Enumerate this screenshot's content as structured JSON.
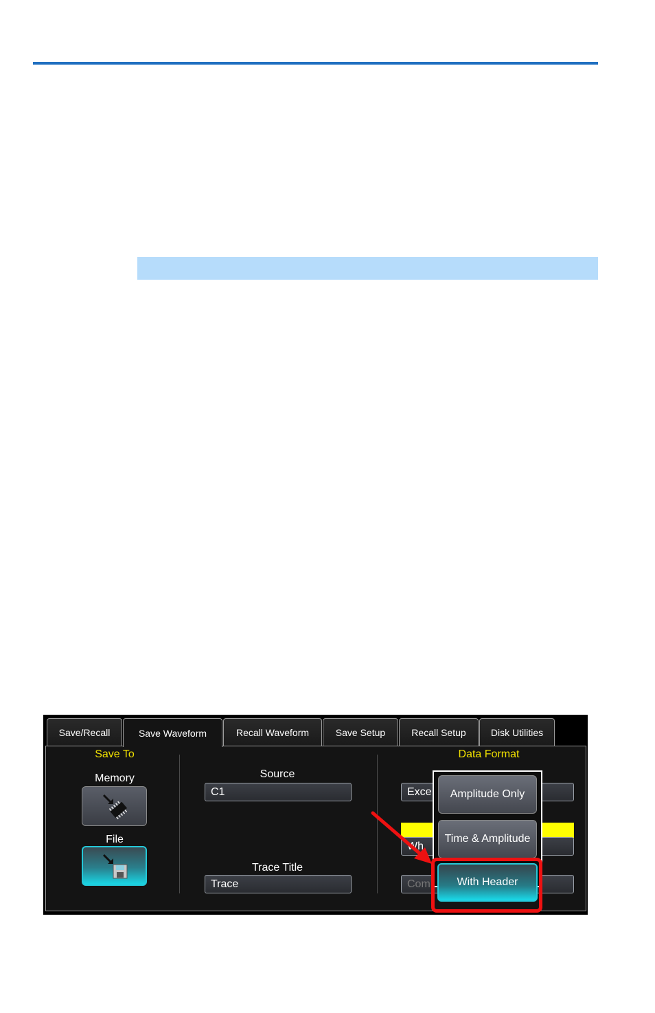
{
  "tabs": [
    "Save/Recall",
    "Save Waveform",
    "Recall Waveform",
    "Save Setup",
    "Recall Setup",
    "Disk Utilities"
  ],
  "save_to": {
    "heading": "Save To",
    "memory_label": "Memory",
    "file_label": "File",
    "memory_icon": "memory-chip-icon",
    "file_icon": "floppy-disk-icon"
  },
  "source": {
    "label": "Source",
    "value": "C1"
  },
  "trace_title": {
    "label": "Trace Title",
    "value": "Trace"
  },
  "data_format": {
    "heading": "Data Format",
    "field1_value": "Exce",
    "field2_value": "Wh",
    "field3_value": "Com",
    "options": [
      "Amplitude Only",
      "Time & Amplitude",
      "With Header"
    ],
    "selected": "With Header"
  },
  "colors": {
    "accent_cyan": "#19d7e6",
    "heading_yellow": "#f0e000",
    "highlight_red": "#ee1111",
    "rule_blue": "#1f6fc0"
  }
}
